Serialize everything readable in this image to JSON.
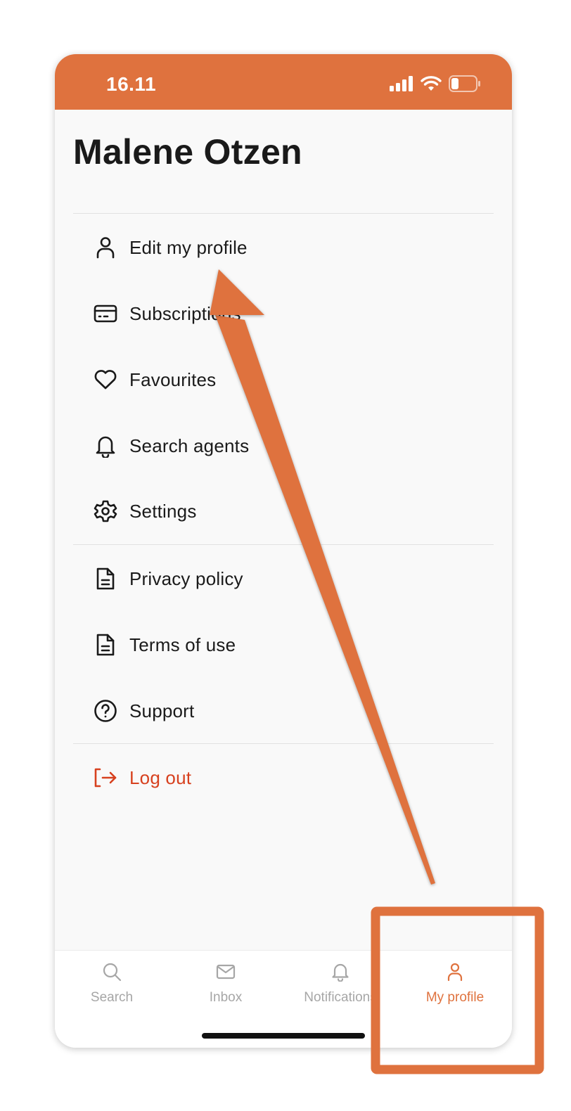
{
  "status_bar": {
    "time": "16.11",
    "background": "#df723e"
  },
  "profile": {
    "name": "Malene Otzen"
  },
  "menu": {
    "items": [
      {
        "label": "Edit my profile",
        "icon": "person-icon"
      },
      {
        "label": "Subscriptions",
        "icon": "credit-card-icon"
      },
      {
        "label": "Favourites",
        "icon": "heart-icon"
      },
      {
        "label": "Search agents",
        "icon": "bell-icon"
      },
      {
        "label": "Settings",
        "icon": "gear-icon"
      }
    ],
    "legal_items": [
      {
        "label": "Privacy policy",
        "icon": "document-icon"
      },
      {
        "label": "Terms of use",
        "icon": "document-icon"
      },
      {
        "label": "Support",
        "icon": "question-circle-icon"
      }
    ],
    "logout": {
      "label": "Log out",
      "icon": "logout-icon",
      "color": "#d7411f"
    }
  },
  "tab_bar": {
    "tabs": [
      {
        "label": "Search",
        "icon": "search-icon",
        "active": false
      },
      {
        "label": "Inbox",
        "icon": "mail-icon",
        "active": false
      },
      {
        "label": "Notifications",
        "icon": "bell-icon",
        "active": false
      },
      {
        "label": "My profile",
        "icon": "person-icon",
        "active": true
      }
    ],
    "active_color": "#df723e",
    "inactive_color": "#a6a6a6"
  },
  "annotation": {
    "color": "#df723e"
  }
}
